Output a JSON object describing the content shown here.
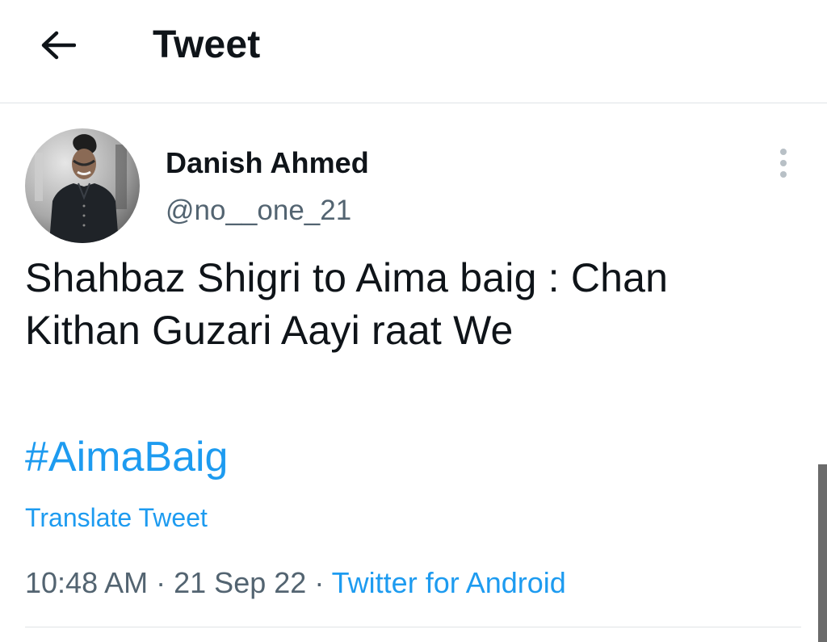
{
  "header": {
    "back_icon": "arrow-left-icon",
    "title": "Tweet"
  },
  "tweet": {
    "author": {
      "display_name": "Danish Ahmed",
      "handle": "@no__one_21",
      "avatar_icon": "profile-photo"
    },
    "more_icon": "vertical-ellipsis-icon",
    "text_line1": "Shahbaz Shigri to Aima baig : Chan",
    "text_line2": "Kithan Guzari Aayi raat We",
    "hashtag": "#AimaBaig",
    "translate_label": "Translate Tweet",
    "time": "10:48 AM",
    "date": "21 Sep 22",
    "separator": "·",
    "source": "Twitter for Android"
  },
  "colors": {
    "accent": "#1d9bf0",
    "secondary_text": "#536471",
    "primary_text": "#0f1419",
    "divider": "#dfe3e6"
  }
}
